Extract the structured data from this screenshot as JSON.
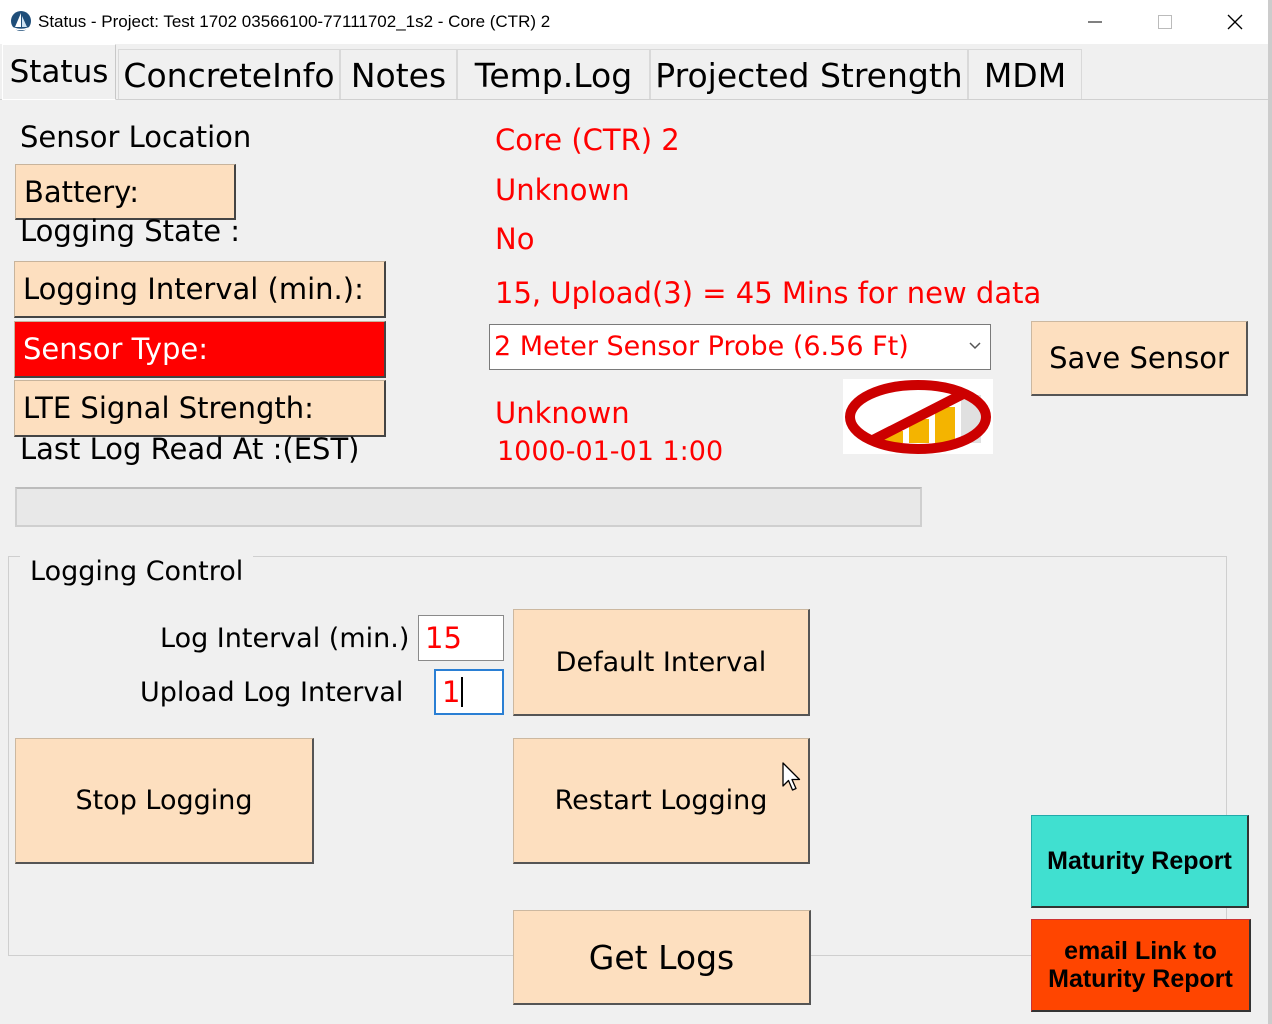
{
  "window": {
    "title": "Status - Project: Test 1702 03566100-77111702_1s2 - Core (CTR) 2",
    "minimize_icon": "minimize-icon",
    "maximize_icon": "maximize-icon",
    "close_icon": "close-icon"
  },
  "tabs": [
    {
      "label": "Status",
      "active": true
    },
    {
      "label": "ConcreteInfo"
    },
    {
      "label": "Notes"
    },
    {
      "label": "Temp.Log"
    },
    {
      "label": "Projected Strength"
    },
    {
      "label": "MDM"
    }
  ],
  "status": {
    "sensor_location_label": "Sensor Location",
    "sensor_location_value": "Core (CTR) 2",
    "battery_label": "Battery:",
    "battery_value": "Unknown",
    "logging_state_label": "Logging State :",
    "logging_state_value": "No",
    "logging_interval_label": "Logging Interval (min.):",
    "logging_interval_value": "15, Upload(3) = 45 Mins for new data",
    "sensor_type_label": "Sensor Type:",
    "sensor_type_selected": "2 Meter Sensor Probe (6.56 Ft)",
    "save_sensor_label": "Save Sensor",
    "lte_label": "LTE Signal Strength:",
    "lte_value": "Unknown",
    "lte_icon": "no-signal-icon",
    "last_log_label": "Last Log Read At :(EST)",
    "last_log_value": "1000-01-01 1:00",
    "progress": 0
  },
  "logging_control": {
    "caption": "Logging Control",
    "log_interval_label": "Log Interval (min.)",
    "log_interval_value": "15",
    "upload_interval_label": "Upload Log Interval",
    "upload_interval_value": "1",
    "default_interval_label": "Default Interval",
    "stop_logging_label": "Stop Logging",
    "restart_logging_label": "Restart Logging",
    "get_logs_label": "Get Logs"
  },
  "reports": {
    "maturity_report_label": "Maturity Report",
    "email_link_line1": "email Link to",
    "email_link_line2": "Maturity Report"
  },
  "colors": {
    "value_text": "#ff0000",
    "button_beige": "#fddfbf",
    "sensor_type_bg": "#ff0000",
    "maturity_bg": "#40e0d0",
    "email_bg": "#ff4500"
  }
}
